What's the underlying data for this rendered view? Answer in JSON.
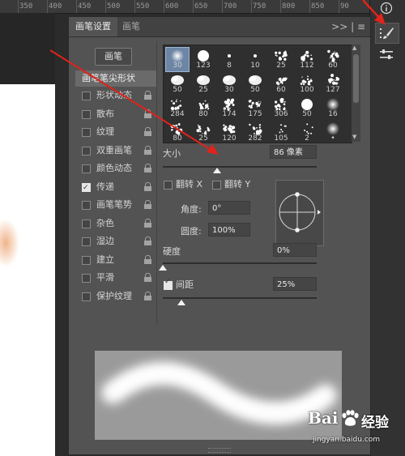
{
  "ruler": {
    "ticks": [
      "350",
      "400",
      "450",
      "500",
      "550",
      "600",
      "650",
      "700",
      "750",
      "800",
      "850",
      "90"
    ]
  },
  "tabs": [
    {
      "label": "画笔设置"
    },
    {
      "label": "画笔"
    }
  ],
  "tab_menu": {
    "label": ">> | ≡"
  },
  "preset_button": {
    "label": "画笔"
  },
  "options": {
    "header": "画笔笔尖形状",
    "items": [
      {
        "label": "形状动态",
        "checked": false
      },
      {
        "label": "散布",
        "checked": false
      },
      {
        "label": "纹理",
        "checked": false
      },
      {
        "label": "双重画笔",
        "checked": false
      },
      {
        "label": "颜色动态",
        "checked": false
      },
      {
        "label": "传递",
        "checked": true
      },
      {
        "label": "画笔笔势",
        "checked": false
      },
      {
        "label": "杂色",
        "checked": false
      },
      {
        "label": "湿边",
        "checked": false
      },
      {
        "label": "建立",
        "checked": false
      },
      {
        "label": "平滑",
        "checked": false
      },
      {
        "label": "保护纹理",
        "checked": false
      }
    ]
  },
  "brush_tips": [
    {
      "size": "30",
      "kind": "soft",
      "selected": true
    },
    {
      "size": "123",
      "kind": "hard"
    },
    {
      "size": "8",
      "kind": "tiny"
    },
    {
      "size": "10",
      "kind": "tiny"
    },
    {
      "size": "25",
      "kind": "splatter"
    },
    {
      "size": "112",
      "kind": "splatter"
    },
    {
      "size": "60",
      "kind": "splatter"
    },
    {
      "size": "50",
      "kind": "cloud"
    },
    {
      "size": "25",
      "kind": "cloud"
    },
    {
      "size": "30",
      "kind": "cloud"
    },
    {
      "size": "50",
      "kind": "cloud"
    },
    {
      "size": "60",
      "kind": "splatter"
    },
    {
      "size": "100",
      "kind": "splatter"
    },
    {
      "size": "127",
      "kind": "splatter"
    },
    {
      "size": "284",
      "kind": "splatter"
    },
    {
      "size": "80",
      "kind": "splatter"
    },
    {
      "size": "174",
      "kind": "splatter"
    },
    {
      "size": "175",
      "kind": "splatter"
    },
    {
      "size": "306",
      "kind": "splatter"
    },
    {
      "size": "50",
      "kind": "hard"
    },
    {
      "size": "16",
      "kind": "soft"
    },
    {
      "size": "80",
      "kind": "splatter"
    },
    {
      "size": "25",
      "kind": "splatter"
    },
    {
      "size": "120",
      "kind": "splatter"
    },
    {
      "size": "282",
      "kind": "splatter"
    },
    {
      "size": "105",
      "kind": "dots"
    },
    {
      "size": "2",
      "kind": "dots"
    },
    {
      "size": "•",
      "kind": "soft"
    }
  ],
  "size": {
    "label": "大小",
    "value": "86 像素",
    "slider": 0.35
  },
  "flip_x": {
    "label": "翻转 X",
    "checked": false
  },
  "flip_y": {
    "label": "翻转 Y",
    "checked": false
  },
  "angle": {
    "label": "角度:",
    "value": "0°"
  },
  "roundness": {
    "label": "圆度:",
    "value": "100%"
  },
  "hardness": {
    "label": "硬度",
    "value": "0%",
    "slider": 0.0
  },
  "spacing": {
    "label": "间距",
    "value": "25%",
    "checked": true,
    "slider": 0.12
  },
  "watermark": {
    "brand": "Bai",
    "brand2": "经验",
    "url": "jingyan.baidu.com"
  },
  "colors": {
    "panel": "#535353",
    "arrow": "#e0231b",
    "selected": "#6d86a5"
  }
}
